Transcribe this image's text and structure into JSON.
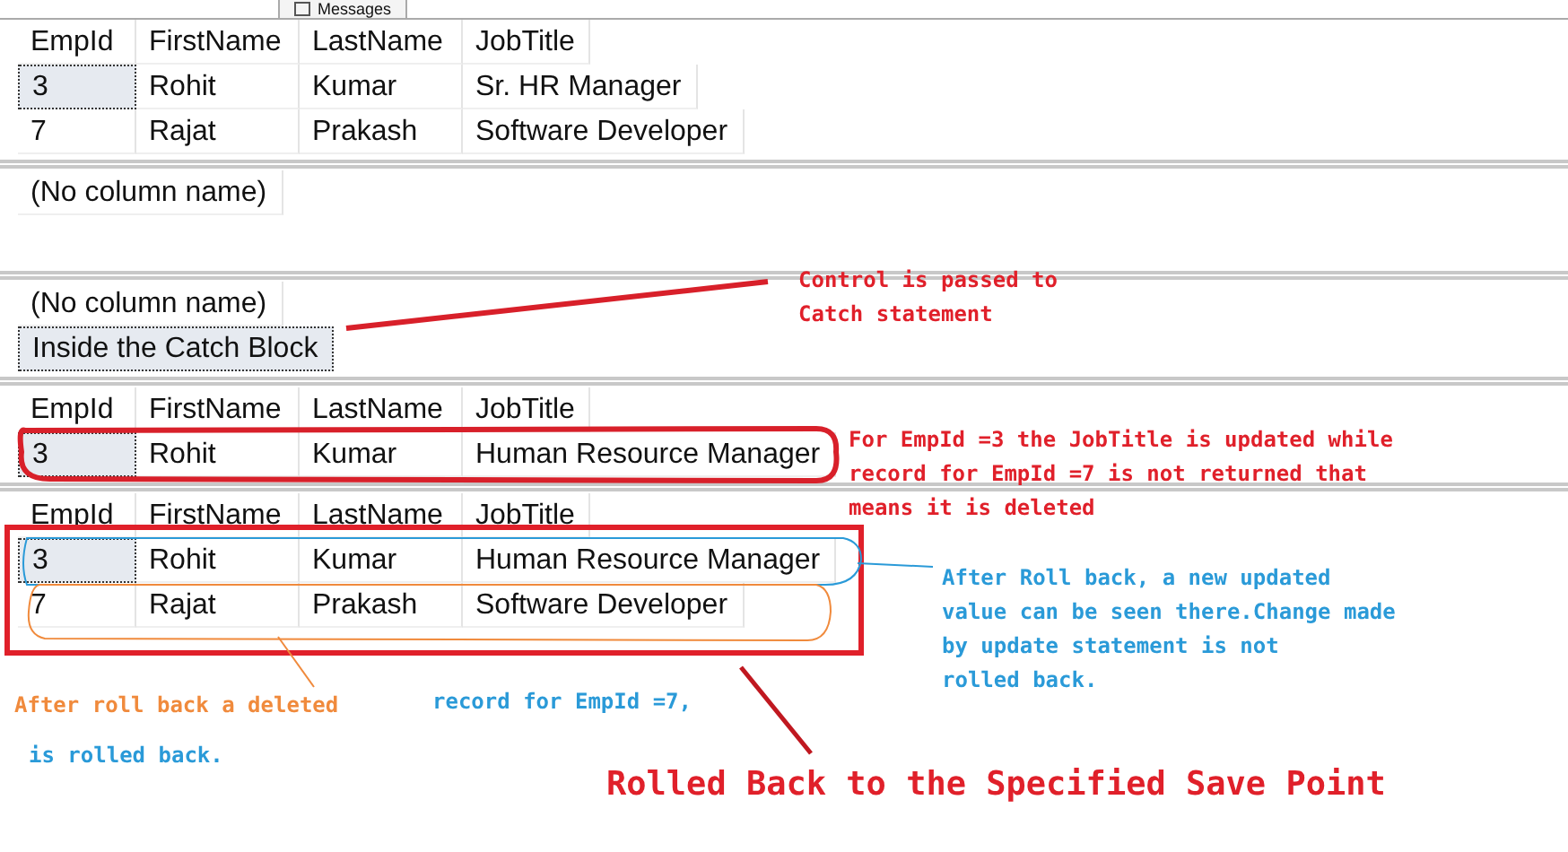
{
  "results_tab": {
    "label": "Messages"
  },
  "grids": [
    {
      "columns": [
        "EmpId",
        "FirstName",
        "LastName",
        "JobTitle"
      ],
      "rows": [
        {
          "cells": [
            {
              "text": "3",
              "selected": true
            },
            {
              "text": "Rohit",
              "selected": false
            },
            {
              "text": "Kumar",
              "selected": false
            },
            {
              "text": "Sr. HR Manager",
              "selected": false
            }
          ]
        },
        {
          "cells": [
            {
              "text": "7",
              "selected": false
            },
            {
              "text": "Rajat",
              "selected": false
            },
            {
              "text": "Prakash",
              "selected": false
            },
            {
              "text": "Software Developer",
              "selected": false
            }
          ]
        }
      ]
    },
    {
      "columns": [
        "(No column name)"
      ]
    },
    {
      "columns": [
        "(No column name)"
      ],
      "rows": [
        {
          "cells": [
            {
              "text": "Inside the Catch Block",
              "selected": true
            }
          ]
        }
      ]
    },
    {
      "columns": [
        "EmpId",
        "FirstName",
        "LastName",
        "JobTitle"
      ],
      "rows": [
        {
          "cells": [
            {
              "text": "3",
              "selected": true
            },
            {
              "text": "Rohit",
              "selected": false
            },
            {
              "text": "Kumar",
              "selected": false
            },
            {
              "text": "Human Resource Manager",
              "selected": false
            }
          ]
        }
      ]
    },
    {
      "columns": [
        "EmpId",
        "FirstName",
        "LastName",
        "JobTitle"
      ],
      "rows": [
        {
          "cells": [
            {
              "text": "3",
              "selected": true
            },
            {
              "text": "Rohit",
              "selected": false
            },
            {
              "text": "Kumar",
              "selected": false
            },
            {
              "text": "Human Resource Manager",
              "selected": false
            }
          ]
        },
        {
          "cells": [
            {
              "text": "7",
              "selected": false
            },
            {
              "text": "Rajat",
              "selected": false
            },
            {
              "text": "Prakash",
              "selected": false
            },
            {
              "text": "Software Developer",
              "selected": false
            }
          ]
        }
      ]
    }
  ],
  "annotations": [
    {
      "kind": "note",
      "text": "Control is passed to\nCatch statement",
      "color": "#e0202a"
    },
    {
      "kind": "note",
      "text": "For EmpId =3 the JobTitle is updated while\nrecord for EmpId =7 is not returned that\nmeans it is deleted",
      "color": "#e0202a"
    },
    {
      "kind": "note",
      "text": "After Roll back, a new updated\nvalue can be seen there.Change made\nby update statement is not\nrolled back.",
      "color": "#2a9ad8"
    },
    {
      "kind": "note",
      "text": "After roll back a deleted",
      "color": "#f08a3c"
    },
    {
      "kind": "note",
      "text": "record for EmpId =7,",
      "color": "#2a9ad8"
    },
    {
      "kind": "note",
      "text": "is rolled back.",
      "color": "#2a9ad8"
    },
    {
      "kind": "title",
      "text": "Rolled Back to the Specified Save Point",
      "color": "#e0202a"
    }
  ]
}
